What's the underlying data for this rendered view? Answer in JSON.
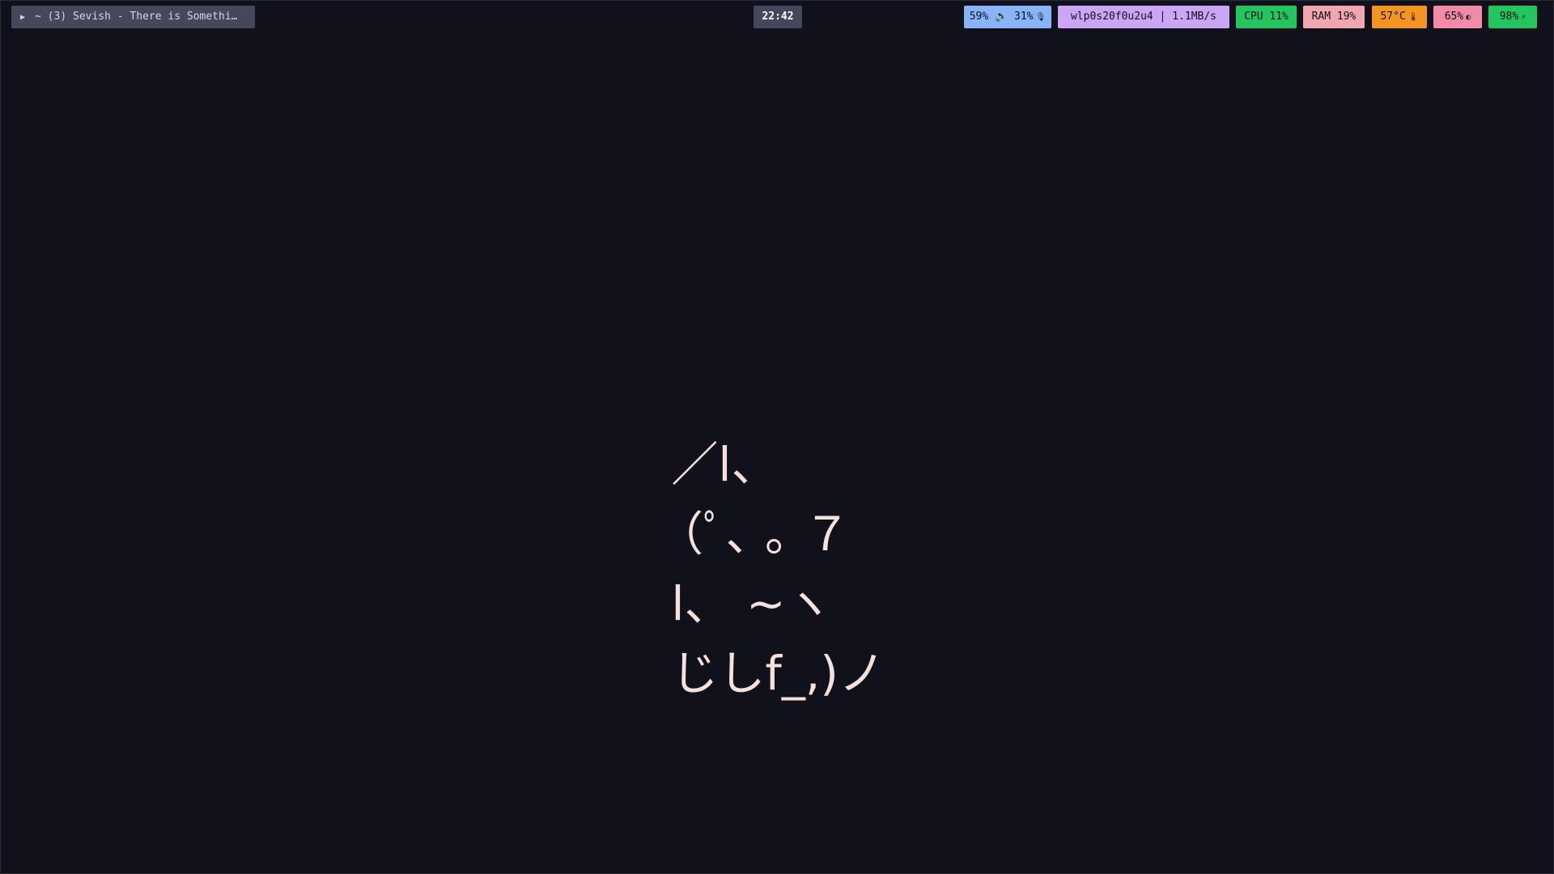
{
  "media": {
    "play_icon": "▶",
    "title": "~ (3) Sevish - There is Somethi…"
  },
  "clock": "22:42",
  "modules": {
    "audio": {
      "text": "59% 🔈 31%",
      "icon": "microphone-icon",
      "glyph": "🎙",
      "color": "#89b4fa"
    },
    "network": {
      "text": "wlp0s20f0u2u4 | 1.1MB/s",
      "color": "#cba6f7"
    },
    "cpu": {
      "text": "CPU 11%",
      "color": "#22c55e"
    },
    "ram": {
      "text": "RAM 19%",
      "color": "#f2a7b0"
    },
    "temperature": {
      "text": "57°C",
      "icon": "thermometer-icon",
      "glyph": "🌡",
      "color": "#f5951f"
    },
    "brightness": {
      "text": "65%",
      "icon": "brightness-icon",
      "glyph": "◐",
      "color": "#f38ba8"
    },
    "battery": {
      "text": "98%",
      "icon": "battery-charging-icon",
      "glyph": "⚡",
      "color": "#22c55e"
    }
  },
  "wallpaper": {
    "ascii_art_lines": [
      " ／l、",
      "（ﾟ､ ｡ ７",
      " l、 ~ヽ",
      " じしf_,)ノ"
    ],
    "text_color": "#f5e0dc",
    "background": "#11111b"
  }
}
